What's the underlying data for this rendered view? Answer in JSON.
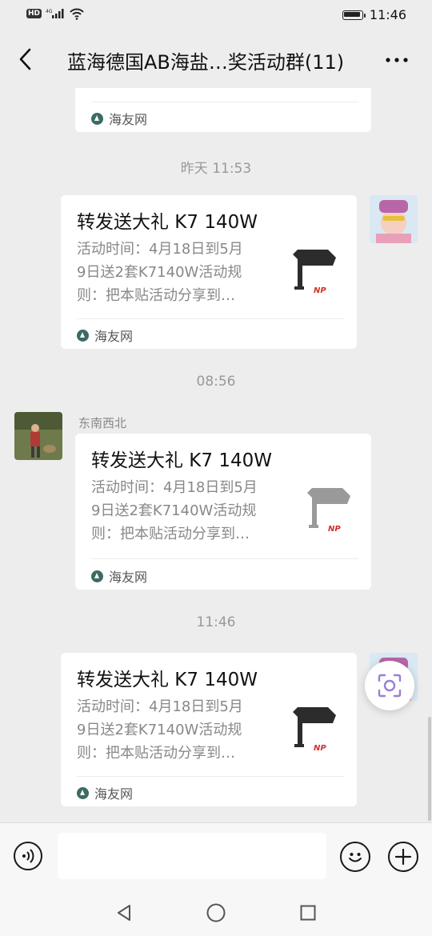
{
  "status_bar": {
    "hd_label": "HD",
    "network_label": "4G",
    "time": "11:46"
  },
  "header": {
    "title": "蓝海德国AB海盐…奖活动群(11)"
  },
  "messages": {
    "top_partial": {
      "source": "海友网"
    },
    "time_1": "昨天 11:53",
    "msg_1": {
      "title": "转发送大礼 K7 140W",
      "desc_line1": "活动时间：4月18日到5月",
      "desc_line2": "9日送2套K7140W活动规",
      "desc_line3": "则：把本贴活动分享到…",
      "thumb_caption": "NP",
      "source": "海友网"
    },
    "time_2": "08:56",
    "msg_2": {
      "sender": "东南西北",
      "title": "转发送大礼 K7 140W",
      "desc_line1": "活动时间：4月18日到5月",
      "desc_line2": "9日送2套K7140W活动规",
      "desc_line3": "则：把本贴活动分享到…",
      "thumb_caption": "NP",
      "source": "海友网"
    },
    "time_3": "11:46",
    "msg_3": {
      "title": "转发送大礼 K7 140W",
      "desc_line1": "活动时间：4月18日到5月",
      "desc_line2": "9日送2套K7140W活动规",
      "desc_line3": "则：把本贴活动分享到…",
      "thumb_caption": "NP",
      "source": "海友网"
    }
  },
  "input_bar": {
    "text_value": "",
    "voice_icon": "voice-icon",
    "emoji_icon": "emoji-icon",
    "plus_icon": "plus-icon"
  },
  "nav_bar": {
    "back_icon": "triangle-back-icon",
    "home_icon": "circle-home-icon",
    "recent_icon": "square-recent-icon"
  },
  "colors": {
    "chat_background": "#ededed",
    "card_background": "#ffffff",
    "secondary_text": "#888888",
    "brand_np": "#d0322a"
  }
}
